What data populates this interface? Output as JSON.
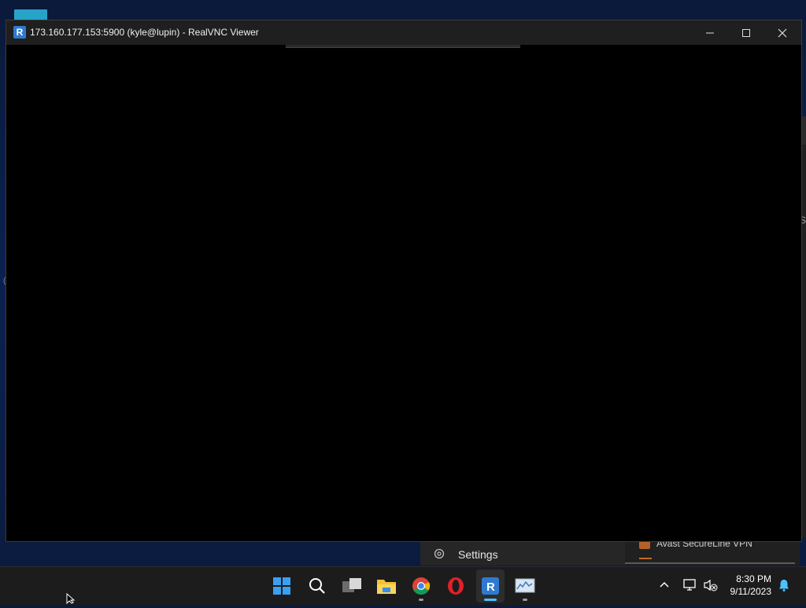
{
  "window": {
    "title": "173.160.177.153:5900 (kyle@lupin) - RealVNC Viewer",
    "app_icon_glyph": "R",
    "icons": [
      "realvnc-icon",
      "minimize-icon",
      "maximize-icon",
      "close-icon"
    ]
  },
  "background": {
    "start_menu_fragment": {
      "settings_label": "Settings",
      "vpn_label": "Avast SecureLine VPN"
    },
    "edge_glyph": "S",
    "edge_glyph_left": "("
  },
  "taskbar": {
    "apps": [
      {
        "name": "start-button",
        "icon": "windows-logo-icon"
      },
      {
        "name": "search-button",
        "icon": "search-icon"
      },
      {
        "name": "task-view-button",
        "icon": "task-view-icon"
      },
      {
        "name": "file-explorer-button",
        "icon": "folder-icon"
      },
      {
        "name": "chrome-button",
        "icon": "chrome-icon"
      },
      {
        "name": "opera-button",
        "icon": "opera-icon"
      },
      {
        "name": "realvnc-button",
        "icon": "realvnc-icon"
      },
      {
        "name": "resource-monitor-button",
        "icon": "monitor-chart-icon"
      }
    ],
    "clock": {
      "time": "8:30 PM",
      "date": "9/11/2023"
    }
  },
  "colors": {
    "accent": "#4cc2ff",
    "titlebar": "#1f1f1f",
    "taskbar": "#1c1c1c",
    "remote_screen": "#000000"
  }
}
